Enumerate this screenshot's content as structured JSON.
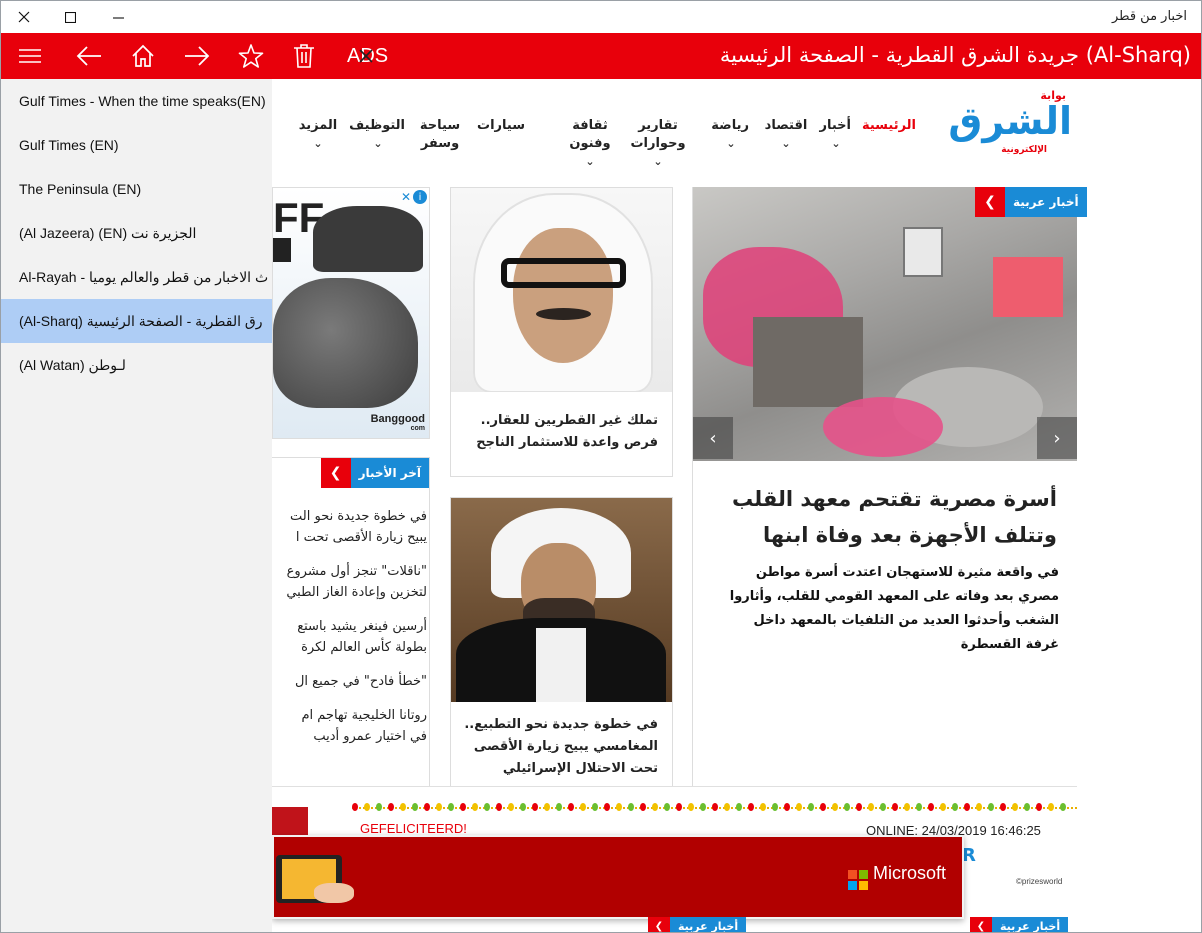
{
  "window": {
    "title": "اخبار من قطر"
  },
  "toolbar": {
    "title": "جريدة الشرق القطرية - الصفحة الرئيسية (Al-Sharq)",
    "ads_label": "ADS",
    "accent": "#e8000b"
  },
  "sidebar": {
    "items": [
      {
        "label": "Gulf Times - When the time speaks(EN)"
      },
      {
        "label": "Gulf Times (EN)"
      },
      {
        "label": "The Peninsula (EN)"
      },
      {
        "label": "(Al Jazeera) (EN) الجزيرة نت"
      },
      {
        "label": "Al-Rayah - ث الاخبار من قطر والعالم يوميا"
      },
      {
        "label": "(Al-Sharq) رق القطرية - الصفحة الرئيسية"
      },
      {
        "label": "(Al Watan) لـوطن"
      }
    ],
    "selected_index": 5
  },
  "site": {
    "logo_main": "الشرق",
    "logo_top": "بوابة",
    "logo_sub": "الإلكترونية",
    "nav": [
      {
        "label": "الرئيسية",
        "has_menu": false
      },
      {
        "label": "أخبار",
        "has_menu": true
      },
      {
        "label": "اقتصاد",
        "has_menu": true
      },
      {
        "label": "رياضة",
        "has_menu": true
      },
      {
        "label": "تقارير وحوارات",
        "has_menu": true
      },
      {
        "label": "ثقافة وفنون",
        "has_menu": true
      },
      {
        "label": "سيارات",
        "has_menu": false
      },
      {
        "label": "سياحة وسفر",
        "has_menu": false
      },
      {
        "label": "التوظيف",
        "has_menu": true
      },
      {
        "label": "المزيد",
        "has_menu": true
      }
    ]
  },
  "main_story": {
    "badge": "أخبار عربية",
    "headline": "أسرة مصرية تقتحم معهد القلب وتتلف الأجهزة بعد وفاة ابنها",
    "description": "في واقعة مثيرة للاستهجان اعتدت أسرة مواطن مصري بعد وفاته على المعهد القومي للقلب، وأثاروا الشغب وأحدثوا العديد من التلفيات بالمعهد داخل غرفة القسطرة"
  },
  "cards": [
    {
      "title": "تملك غير القطريين للعقار.. فرص واعدة للاستثمار الناجح"
    },
    {
      "title": "في خطوة جديدة نحو التطبيع.. المغامسي يبيح زيارة الأقصى تحت الاحتلال الإسرائيلي"
    }
  ],
  "ad": {
    "text": "FF",
    "brand": "Banggood",
    "brand_sub": "com"
  },
  "latest_news": {
    "badge": "آخر الأخبار",
    "items": [
      "في خطوة جديدة نحو الت",
      "يبيح زيارة الأقصى تحت ا",
      "\"ناقلات\" تنجز أول مشروع",
      "لتخزين وإعادة الغاز الطبي",
      "أرسين فينغر يشيد باستع",
      "بطولة كأس العالم لكرة",
      "\"خطأ فادح\" في جميع ال",
      "روتانا الخليجية تهاجم ام",
      "في اختيار عمرو أديب"
    ]
  },
  "prize": {
    "left_text": "GEFELICITEERD!",
    "date_text": "ONLINE: 24/03/2019 16:46:25",
    "brand": "©prizesworld",
    "letter": "R"
  },
  "ms_banner": {
    "brand": "Microsoft"
  },
  "bottom_badges": [
    "أخبار عربية",
    "أخبار عربية"
  ]
}
